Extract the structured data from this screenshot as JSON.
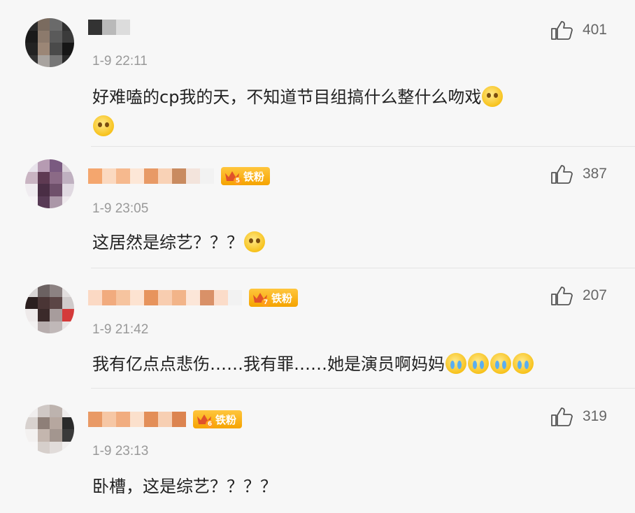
{
  "comments": [
    {
      "time": "1-9 22:11",
      "likes": "401",
      "text": "好难嗑的cp我的天，不知道节目组搞什么整什么吻戏",
      "badge": "",
      "emoji": [
        "smirk-emoji",
        "smirk-emoji"
      ]
    },
    {
      "time": "1-9 23:05",
      "likes": "387",
      "text": "这居然是综艺？？？",
      "badge": "铁粉",
      "emoji": [
        "smirk-emoji"
      ]
    },
    {
      "time": "1-9 21:42",
      "likes": "207",
      "text": "我有亿点点悲伤……我有罪……她是演员啊妈妈",
      "badge": "铁粉",
      "emoji": [
        "crying-emoji",
        "crying-emoji",
        "crying-emoji",
        "crying-emoji"
      ]
    },
    {
      "time": "1-9 23:13",
      "likes": "319",
      "text": "卧槽，这是综艺？？？？",
      "badge": "铁粉",
      "emoji": []
    }
  ],
  "icons": {
    "like": "thumbs-up-icon",
    "badge": "crown-icon"
  },
  "colors": {
    "badge_bg": "#f5a300",
    "time": "#999999",
    "text": "#222222",
    "divider": "#e4e4e4"
  }
}
